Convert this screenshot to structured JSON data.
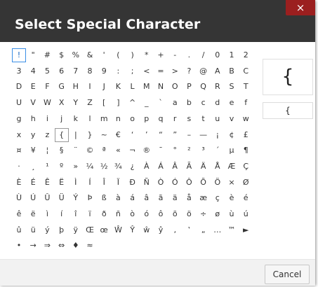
{
  "dialog": {
    "title": "Select Special Character",
    "close_label": "×",
    "cancel_label": "Cancel"
  },
  "preview": {
    "char": "{",
    "code": "{"
  },
  "selected_char": "!",
  "hovered_char": "{",
  "characters": [
    [
      "!",
      "\"",
      "#",
      "$",
      "%",
      "&",
      "'",
      "(",
      ")",
      "*",
      "+",
      "-",
      ".",
      "/",
      "0",
      "1",
      "2"
    ],
    [
      "3",
      "4",
      "5",
      "6",
      "7",
      "8",
      "9",
      ":",
      ";",
      "<",
      "=",
      ">",
      "?",
      "@",
      "A",
      "B",
      "C"
    ],
    [
      "D",
      "E",
      "F",
      "G",
      "H",
      "I",
      "J",
      "K",
      "L",
      "M",
      "N",
      "O",
      "P",
      "Q",
      "R",
      "S",
      "T"
    ],
    [
      "U",
      "V",
      "W",
      "X",
      "Y",
      "Z",
      "[",
      "]",
      "^",
      "_",
      "`",
      "a",
      "b",
      "c",
      "d",
      "e",
      "f"
    ],
    [
      "g",
      "h",
      "i",
      "j",
      "k",
      "l",
      "m",
      "n",
      "o",
      "p",
      "q",
      "r",
      "s",
      "t",
      "u",
      "v",
      "w"
    ],
    [
      "x",
      "y",
      "z",
      "{",
      "|",
      "}",
      "~",
      "€",
      "‘",
      "’",
      "“",
      "”",
      "–",
      "—",
      "¡",
      "¢",
      "£"
    ],
    [
      "¤",
      "¥",
      "¦",
      "§",
      "¨",
      "©",
      "ª",
      "«",
      "¬",
      "®",
      "¯",
      "°",
      "²",
      "³",
      "´",
      "µ",
      "¶"
    ],
    [
      "·",
      "¸",
      "¹",
      "º",
      "»",
      "¼",
      "½",
      "¾",
      "¿",
      "À",
      "Á",
      "Â",
      "Ã",
      "Ä",
      "Å",
      "Æ",
      "Ç"
    ],
    [
      "È",
      "É",
      "Ê",
      "Ë",
      "Ì",
      "Í",
      "Î",
      "Ï",
      "Ð",
      "Ñ",
      "Ò",
      "Ó",
      "Ô",
      "Õ",
      "Ö",
      "×",
      "Ø"
    ],
    [
      "Ù",
      "Ú",
      "Û",
      "Ü",
      "Ý",
      "Þ",
      "ß",
      "à",
      "á",
      "â",
      "ã",
      "ä",
      "å",
      "æ",
      "ç",
      "è",
      "é"
    ],
    [
      "ê",
      "ë",
      "ì",
      "í",
      "î",
      "ï",
      "ð",
      "ñ",
      "ò",
      "ó",
      "ô",
      "õ",
      "ö",
      "÷",
      "ø",
      "ù",
      "ú"
    ],
    [
      "û",
      "ü",
      "ý",
      "þ",
      "ÿ",
      "Œ",
      "œ",
      "Ŵ",
      "Ŷ",
      "ŵ",
      "ŷ",
      "‚",
      "‛",
      "„",
      "…",
      "™",
      "►"
    ],
    [
      "•",
      "→",
      "⇒",
      "⇔",
      "♦",
      "≈"
    ]
  ]
}
